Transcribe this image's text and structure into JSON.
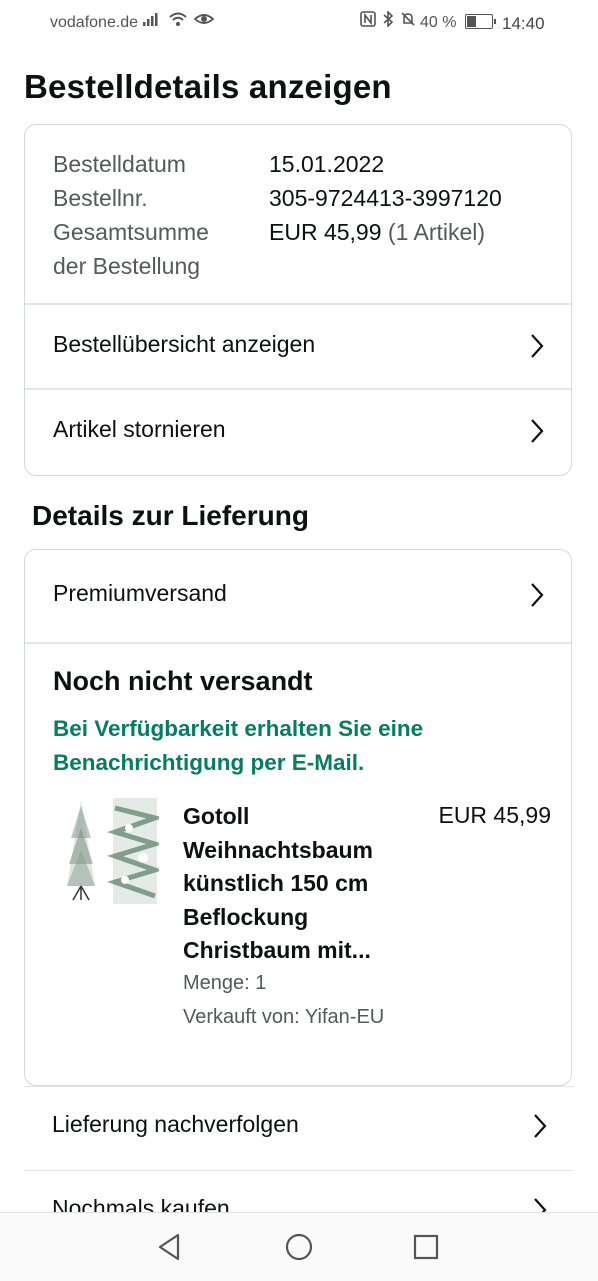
{
  "status_bar": {
    "carrier": "vodafone.de",
    "battery_percent": "40 %",
    "time": "14:40",
    "icons": [
      "signal-icon",
      "wifi-icon",
      "eye-icon",
      "nfc-icon",
      "bluetooth-icon",
      "mute-icon",
      "battery-icon"
    ]
  },
  "page": {
    "title": "Bestelldetails anzeigen"
  },
  "order_info": {
    "date_label": "Bestelldatum",
    "date_value": "15.01.2022",
    "number_label": "Bestellnr.",
    "number_value": "305-9724413-3997120",
    "total_label_line1": "Gesamtsumme",
    "total_label_line2": "der Bestellung",
    "total_value": "EUR 45,99",
    "total_items": "(1 Artikel)"
  },
  "order_actions": {
    "overview_label": "Bestellübersicht anzeigen",
    "cancel_label": "Artikel stornieren"
  },
  "delivery": {
    "section_title": "Details zur Lieferung",
    "shipping_method": "Premiumversand",
    "status": "Noch nicht versandt",
    "note": "Bei Verfügbarkeit erhalten Sie eine Benachrichtigung per E-Mail."
  },
  "product": {
    "title_lines": [
      "Gotoll",
      "Weihnachtsbaum",
      "künstlich 150 cm",
      "Beflockung",
      "Christbaum mit..."
    ],
    "price": "EUR 45,99",
    "quantity": "Menge: 1",
    "seller": "Verkauft von: Yifan-EU"
  },
  "bottom_actions": {
    "track_label": "Lieferung nachverfolgen",
    "buy_again_label": "Nochmals kaufen"
  },
  "colors": {
    "accent_green": "#067d62",
    "text_primary": "#0f1111",
    "text_secondary": "#565959",
    "border": "#d5d9d9"
  }
}
